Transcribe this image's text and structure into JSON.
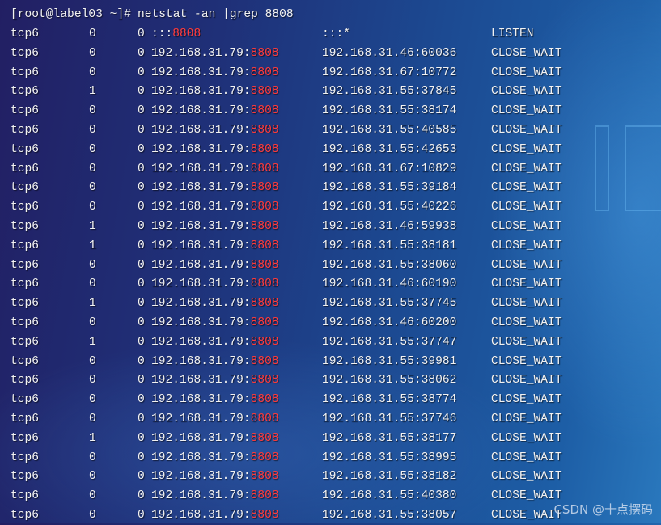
{
  "terminal": {
    "prompt": "[root@label03 ~]# ",
    "command": "netstat -an |grep 8808",
    "highlight_color": "#ff3b3b",
    "rows": [
      {
        "proto": "tcp6",
        "recv": "0",
        "send": "0",
        "local_ip": ":::",
        "local_port": "8808",
        "foreign": ":::*",
        "state": "LISTEN"
      },
      {
        "proto": "tcp6",
        "recv": "0",
        "send": "0",
        "local_ip": "192.168.31.79:",
        "local_port": "8808",
        "foreign": "192.168.31.46:60036",
        "state": "CLOSE_WAIT"
      },
      {
        "proto": "tcp6",
        "recv": "0",
        "send": "0",
        "local_ip": "192.168.31.79:",
        "local_port": "8808",
        "foreign": "192.168.31.67:10772",
        "state": "CLOSE_WAIT"
      },
      {
        "proto": "tcp6",
        "recv": "1",
        "send": "0",
        "local_ip": "192.168.31.79:",
        "local_port": "8808",
        "foreign": "192.168.31.55:37845",
        "state": "CLOSE_WAIT"
      },
      {
        "proto": "tcp6",
        "recv": "0",
        "send": "0",
        "local_ip": "192.168.31.79:",
        "local_port": "8808",
        "foreign": "192.168.31.55:38174",
        "state": "CLOSE_WAIT"
      },
      {
        "proto": "tcp6",
        "recv": "0",
        "send": "0",
        "local_ip": "192.168.31.79:",
        "local_port": "8808",
        "foreign": "192.168.31.55:40585",
        "state": "CLOSE_WAIT"
      },
      {
        "proto": "tcp6",
        "recv": "0",
        "send": "0",
        "local_ip": "192.168.31.79:",
        "local_port": "8808",
        "foreign": "192.168.31.55:42653",
        "state": "CLOSE_WAIT"
      },
      {
        "proto": "tcp6",
        "recv": "0",
        "send": "0",
        "local_ip": "192.168.31.79:",
        "local_port": "8808",
        "foreign": "192.168.31.67:10829",
        "state": "CLOSE_WAIT"
      },
      {
        "proto": "tcp6",
        "recv": "0",
        "send": "0",
        "local_ip": "192.168.31.79:",
        "local_port": "8808",
        "foreign": "192.168.31.55:39184",
        "state": "CLOSE_WAIT"
      },
      {
        "proto": "tcp6",
        "recv": "0",
        "send": "0",
        "local_ip": "192.168.31.79:",
        "local_port": "8808",
        "foreign": "192.168.31.55:40226",
        "state": "CLOSE_WAIT"
      },
      {
        "proto": "tcp6",
        "recv": "1",
        "send": "0",
        "local_ip": "192.168.31.79:",
        "local_port": "8808",
        "foreign": "192.168.31.46:59938",
        "state": "CLOSE_WAIT"
      },
      {
        "proto": "tcp6",
        "recv": "1",
        "send": "0",
        "local_ip": "192.168.31.79:",
        "local_port": "8808",
        "foreign": "192.168.31.55:38181",
        "state": "CLOSE_WAIT"
      },
      {
        "proto": "tcp6",
        "recv": "0",
        "send": "0",
        "local_ip": "192.168.31.79:",
        "local_port": "8808",
        "foreign": "192.168.31.55:38060",
        "state": "CLOSE_WAIT"
      },
      {
        "proto": "tcp6",
        "recv": "0",
        "send": "0",
        "local_ip": "192.168.31.79:",
        "local_port": "8808",
        "foreign": "192.168.31.46:60190",
        "state": "CLOSE_WAIT"
      },
      {
        "proto": "tcp6",
        "recv": "1",
        "send": "0",
        "local_ip": "192.168.31.79:",
        "local_port": "8808",
        "foreign": "192.168.31.55:37745",
        "state": "CLOSE_WAIT"
      },
      {
        "proto": "tcp6",
        "recv": "0",
        "send": "0",
        "local_ip": "192.168.31.79:",
        "local_port": "8808",
        "foreign": "192.168.31.46:60200",
        "state": "CLOSE_WAIT"
      },
      {
        "proto": "tcp6",
        "recv": "1",
        "send": "0",
        "local_ip": "192.168.31.79:",
        "local_port": "8808",
        "foreign": "192.168.31.55:37747",
        "state": "CLOSE_WAIT"
      },
      {
        "proto": "tcp6",
        "recv": "0",
        "send": "0",
        "local_ip": "192.168.31.79:",
        "local_port": "8808",
        "foreign": "192.168.31.55:39981",
        "state": "CLOSE_WAIT"
      },
      {
        "proto": "tcp6",
        "recv": "0",
        "send": "0",
        "local_ip": "192.168.31.79:",
        "local_port": "8808",
        "foreign": "192.168.31.55:38062",
        "state": "CLOSE_WAIT"
      },
      {
        "proto": "tcp6",
        "recv": "0",
        "send": "0",
        "local_ip": "192.168.31.79:",
        "local_port": "8808",
        "foreign": "192.168.31.55:38774",
        "state": "CLOSE_WAIT"
      },
      {
        "proto": "tcp6",
        "recv": "0",
        "send": "0",
        "local_ip": "192.168.31.79:",
        "local_port": "8808",
        "foreign": "192.168.31.55:37746",
        "state": "CLOSE_WAIT"
      },
      {
        "proto": "tcp6",
        "recv": "1",
        "send": "0",
        "local_ip": "192.168.31.79:",
        "local_port": "8808",
        "foreign": "192.168.31.55:38177",
        "state": "CLOSE_WAIT"
      },
      {
        "proto": "tcp6",
        "recv": "0",
        "send": "0",
        "local_ip": "192.168.31.79:",
        "local_port": "8808",
        "foreign": "192.168.31.55:38995",
        "state": "CLOSE_WAIT"
      },
      {
        "proto": "tcp6",
        "recv": "0",
        "send": "0",
        "local_ip": "192.168.31.79:",
        "local_port": "8808",
        "foreign": "192.168.31.55:38182",
        "state": "CLOSE_WAIT"
      },
      {
        "proto": "tcp6",
        "recv": "0",
        "send": "0",
        "local_ip": "192.168.31.79:",
        "local_port": "8808",
        "foreign": "192.168.31.55:40380",
        "state": "CLOSE_WAIT"
      },
      {
        "proto": "tcp6",
        "recv": "0",
        "send": "0",
        "local_ip": "192.168.31.79:",
        "local_port": "8808",
        "foreign": "192.168.31.55:38057",
        "state": "CLOSE_WAIT"
      }
    ]
  },
  "watermark": "CSDN @十点摆码"
}
